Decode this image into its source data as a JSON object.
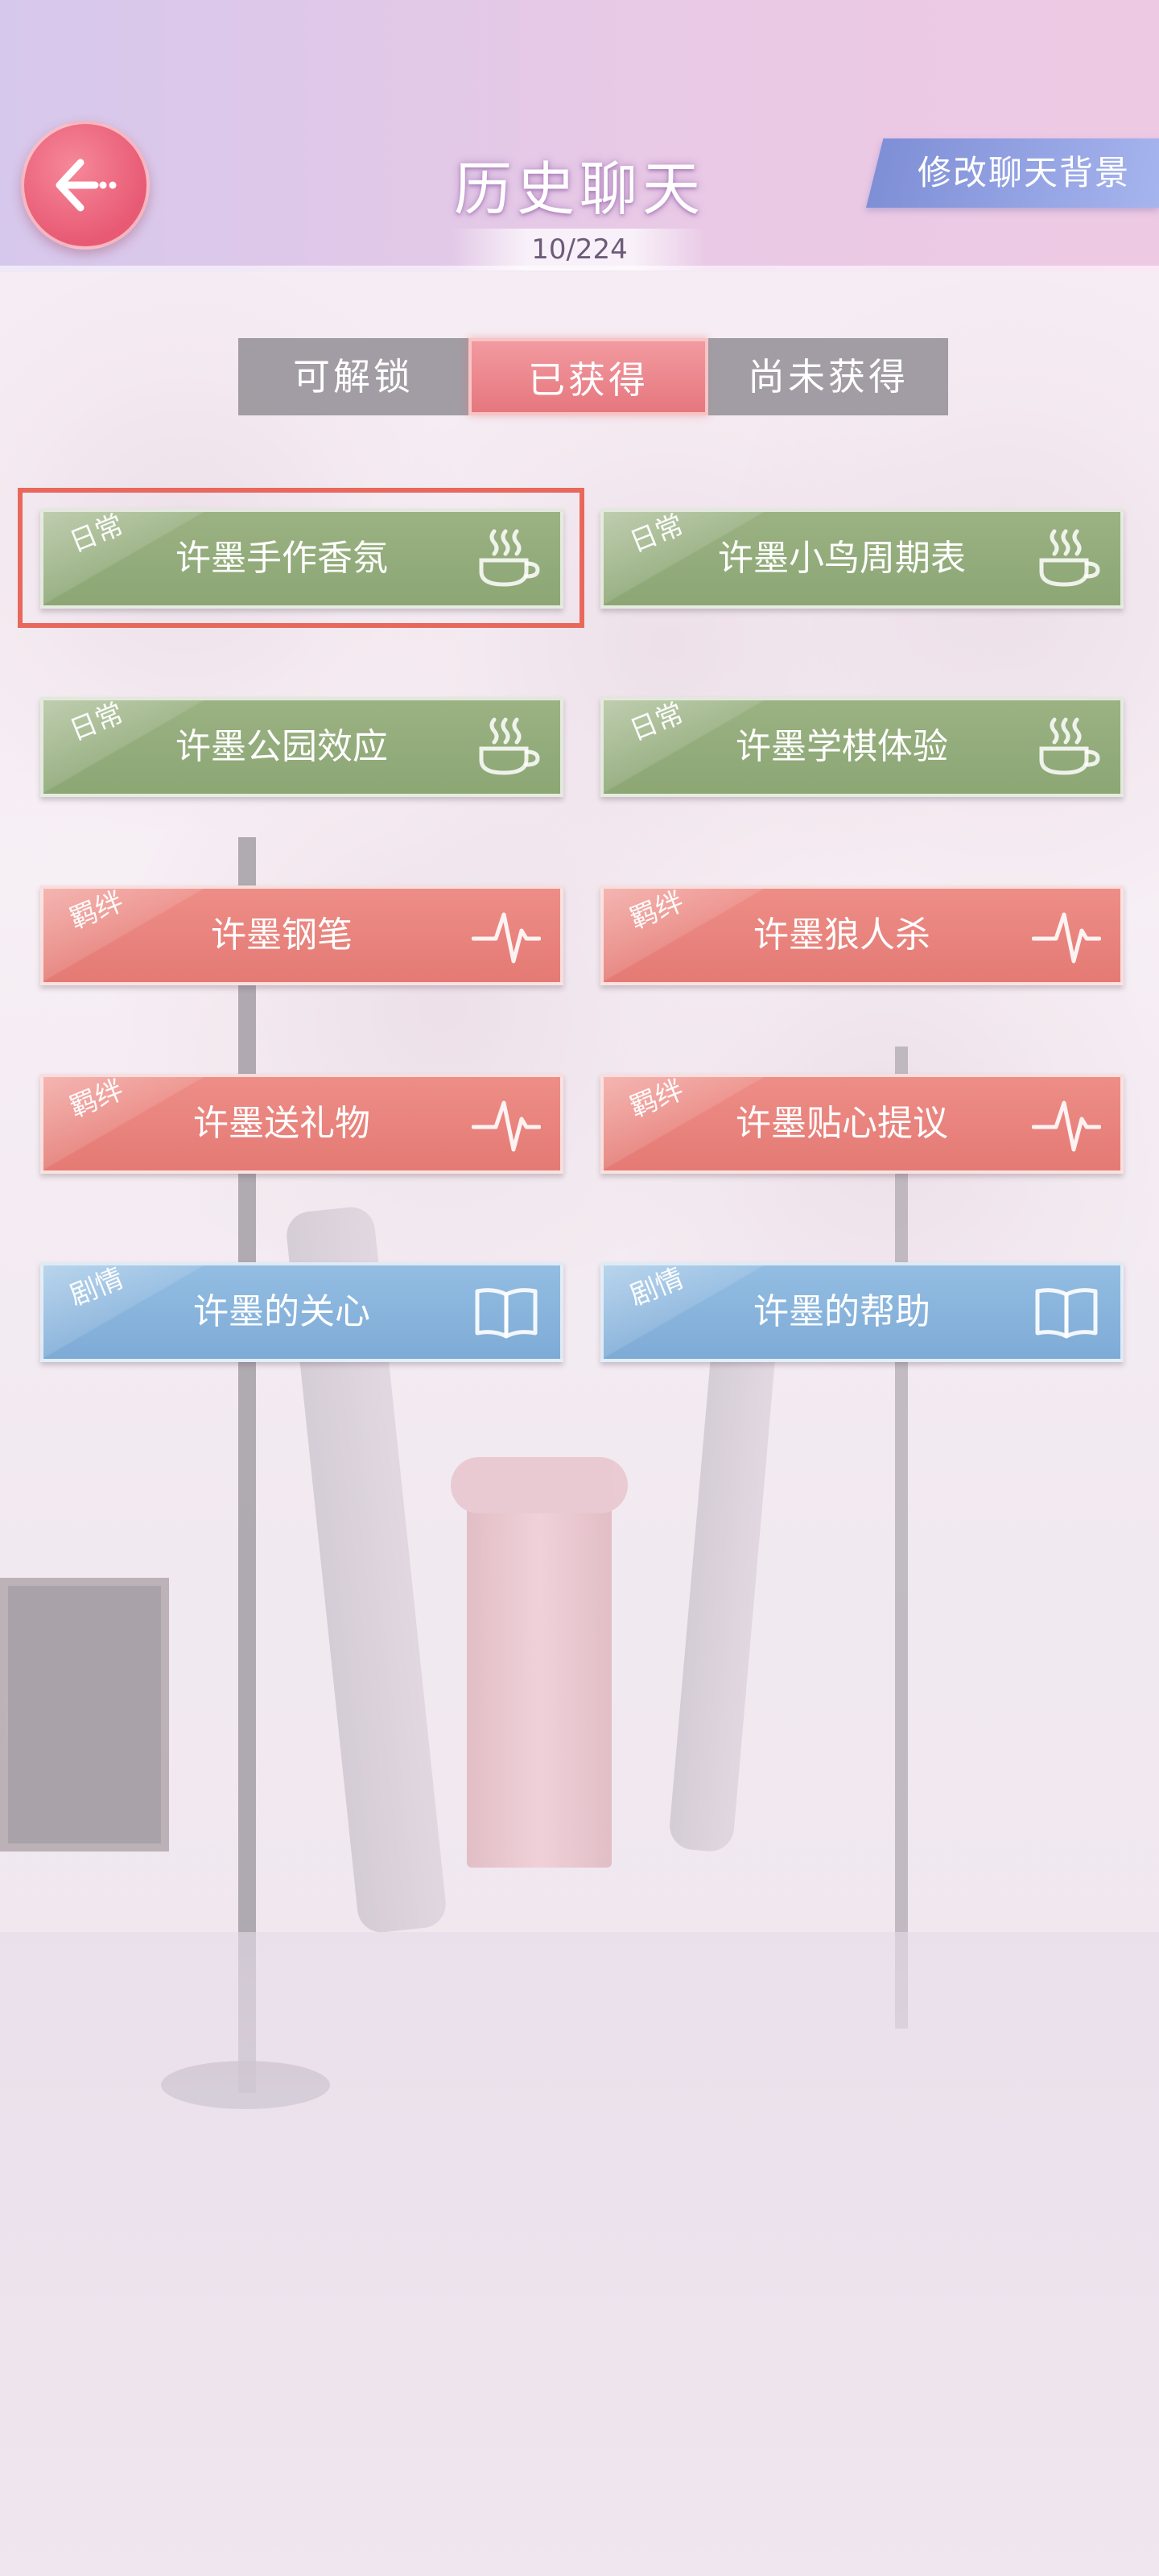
{
  "header": {
    "title": "历史聊天",
    "count": "10/224",
    "change_background_label": "修改聊天背景"
  },
  "tabs": [
    {
      "label": "可解锁",
      "selected": false
    },
    {
      "label": "已获得",
      "selected": true
    },
    {
      "label": "尚未获得",
      "selected": false
    }
  ],
  "cards": [
    {
      "tag": "日常",
      "title": "许墨手作香氛",
      "type": "daily",
      "icon": "coffee-cup-icon",
      "highlighted": true
    },
    {
      "tag": "日常",
      "title": "许墨小鸟周期表",
      "type": "daily",
      "icon": "coffee-cup-icon"
    },
    {
      "tag": "日常",
      "title": "许墨公园效应",
      "type": "daily",
      "icon": "coffee-cup-icon"
    },
    {
      "tag": "日常",
      "title": "许墨学棋体验",
      "type": "daily",
      "icon": "coffee-cup-icon"
    },
    {
      "tag": "羁绊",
      "title": "许墨钢笔",
      "type": "bond",
      "icon": "heartbeat-icon"
    },
    {
      "tag": "羁绊",
      "title": "许墨狼人杀",
      "type": "bond",
      "icon": "heartbeat-icon"
    },
    {
      "tag": "羁绊",
      "title": "许墨送礼物",
      "type": "bond",
      "icon": "heartbeat-icon"
    },
    {
      "tag": "羁绊",
      "title": "许墨贴心提议",
      "type": "bond",
      "icon": "heartbeat-icon"
    },
    {
      "tag": "剧情",
      "title": "许墨的关心",
      "type": "story",
      "icon": "open-book-icon"
    },
    {
      "tag": "剧情",
      "title": "许墨的帮助",
      "type": "story",
      "icon": "open-book-icon"
    }
  ],
  "colors": {
    "daily": "#8ca674",
    "bond": "#e47a74",
    "story": "#7eabd6",
    "highlight": "#e8685c",
    "back_button": "#e85a74"
  }
}
